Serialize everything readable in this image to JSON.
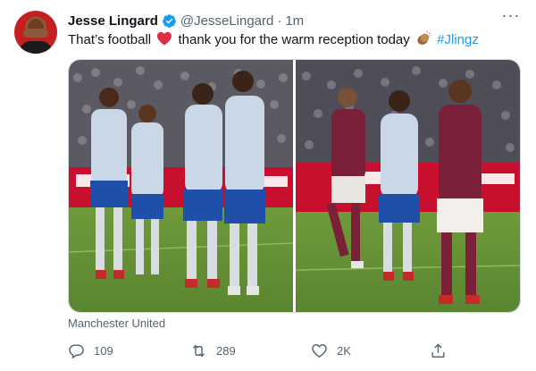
{
  "tweet": {
    "display_name": "Jesse Lingard",
    "handle": "@JesseLingard",
    "separator": "·",
    "time": "1m",
    "more_label": "···",
    "text_part1": "That’s football",
    "text_part2": "thank you for the warm reception today",
    "hashtag": "#Jlingz",
    "icons": {
      "verified": "verified-badge-icon",
      "heart_emoji": "red-heart-emoji",
      "clap_emoji": "clapping-hands-emoji"
    },
    "media_source": "Manchester United"
  },
  "actions": {
    "reply_count": "109",
    "retweet_count": "289",
    "like_count": "2K"
  },
  "colors": {
    "accent": "#1d9bf0",
    "text": "#0f1419",
    "muted": "#536471",
    "heart": "#e0245e"
  }
}
